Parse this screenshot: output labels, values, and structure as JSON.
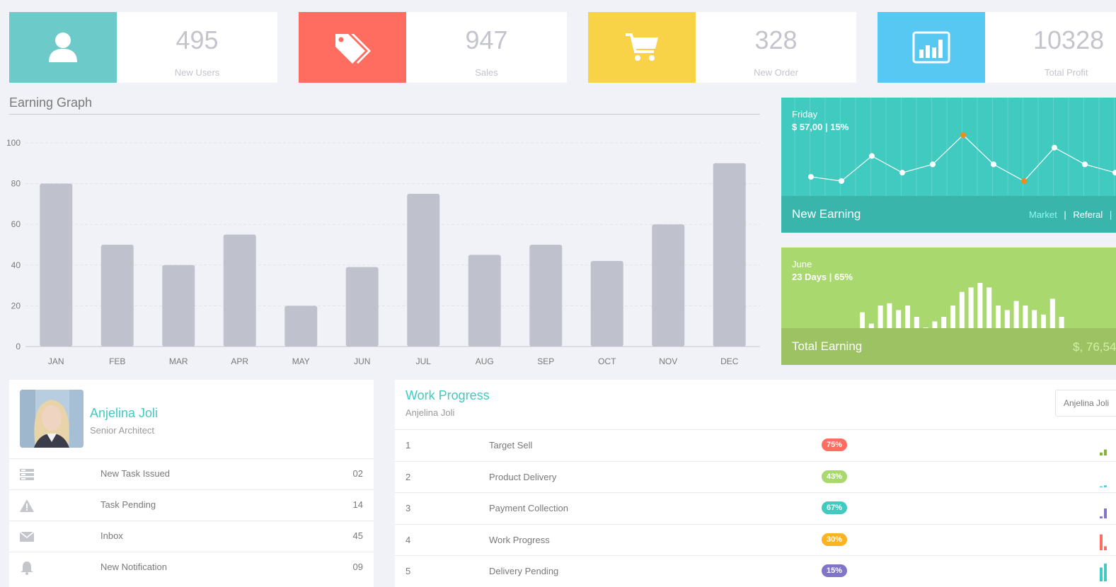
{
  "stats": [
    {
      "value": "495",
      "label": "New Users",
      "color": "#6ccac9",
      "icon": "user-icon"
    },
    {
      "value": "947",
      "label": "Sales",
      "color": "#ff6c60",
      "icon": "tags-icon"
    },
    {
      "value": "328",
      "label": "New Order",
      "color": "#f8d347",
      "icon": "shopping-cart-icon"
    },
    {
      "value": "10328",
      "label": "Total Profit",
      "color": "#57c8f2",
      "icon": "bar-chart-icon"
    }
  ],
  "earning_graph": {
    "title": "Earning Graph"
  },
  "chart_data": {
    "type": "bar",
    "title": "Earning Graph",
    "categories": [
      "JAN",
      "FEB",
      "MAR",
      "APR",
      "MAY",
      "JUN",
      "JUL",
      "AUG",
      "SEP",
      "OCT",
      "NOV",
      "DEC"
    ],
    "values": [
      80,
      50,
      40,
      55,
      20,
      39,
      75,
      45,
      50,
      42,
      60,
      90
    ],
    "yticks": [
      0,
      20,
      40,
      60,
      80,
      100
    ],
    "ylim": [
      0,
      100
    ],
    "grid": true,
    "bar_color": "#bfc2cd"
  },
  "new_earning": {
    "day": "Friday",
    "amount": "$ 57,00 | 15%",
    "title": "New Earning",
    "links": [
      "Market",
      "Referal"
    ],
    "line_values": [
      5,
      4,
      10,
      6,
      8,
      15,
      8,
      4,
      12,
      8,
      6
    ],
    "highlight_points": [
      5,
      7
    ],
    "color": "#41cac0"
  },
  "total_earning": {
    "month": "June",
    "days": "23 Days | 65%",
    "title": "Total Earning",
    "amount": "$, 76,54",
    "bar_values": [
      7,
      2,
      10,
      11,
      8,
      10,
      5,
      0,
      3,
      5,
      10,
      16,
      18,
      20,
      18,
      10,
      8,
      12,
      10,
      8,
      6,
      13,
      5
    ],
    "color": "#a9d86e"
  },
  "profile": {
    "name": "Anjelina Joli",
    "role": "Senior Architect",
    "items": [
      {
        "label": "New Task Issued",
        "value": "02",
        "icon": "server-icon"
      },
      {
        "label": "Task Pending",
        "value": "14",
        "icon": "warning-icon"
      },
      {
        "label": "Inbox",
        "value": "45",
        "icon": "envelope-icon"
      },
      {
        "label": "New Notification",
        "value": "09",
        "icon": "bell-icon"
      }
    ]
  },
  "work_progress": {
    "title": "Work Progress",
    "subtitle": "Anjelina Joli",
    "select_value": "Anjelina Joli",
    "rows": [
      {
        "num": "1",
        "task": "Target Sell",
        "percent": "75%",
        "color": "#ff6c60",
        "spark_color": "#7fb636"
      },
      {
        "num": "2",
        "task": "Product Delivery",
        "percent": "43%",
        "color": "#a9d86e",
        "spark_color": "#57c8f2"
      },
      {
        "num": "3",
        "task": "Payment Collection",
        "percent": "67%",
        "color": "#41cac0",
        "spark_color": "#8175c7"
      },
      {
        "num": "4",
        "task": "Work Progress",
        "percent": "30%",
        "color": "#fcb322",
        "spark_color": "#ff6c60"
      },
      {
        "num": "5",
        "task": "Delivery Pending",
        "percent": "15%",
        "color": "#8175c7",
        "spark_color": "#41cac0"
      }
    ]
  }
}
